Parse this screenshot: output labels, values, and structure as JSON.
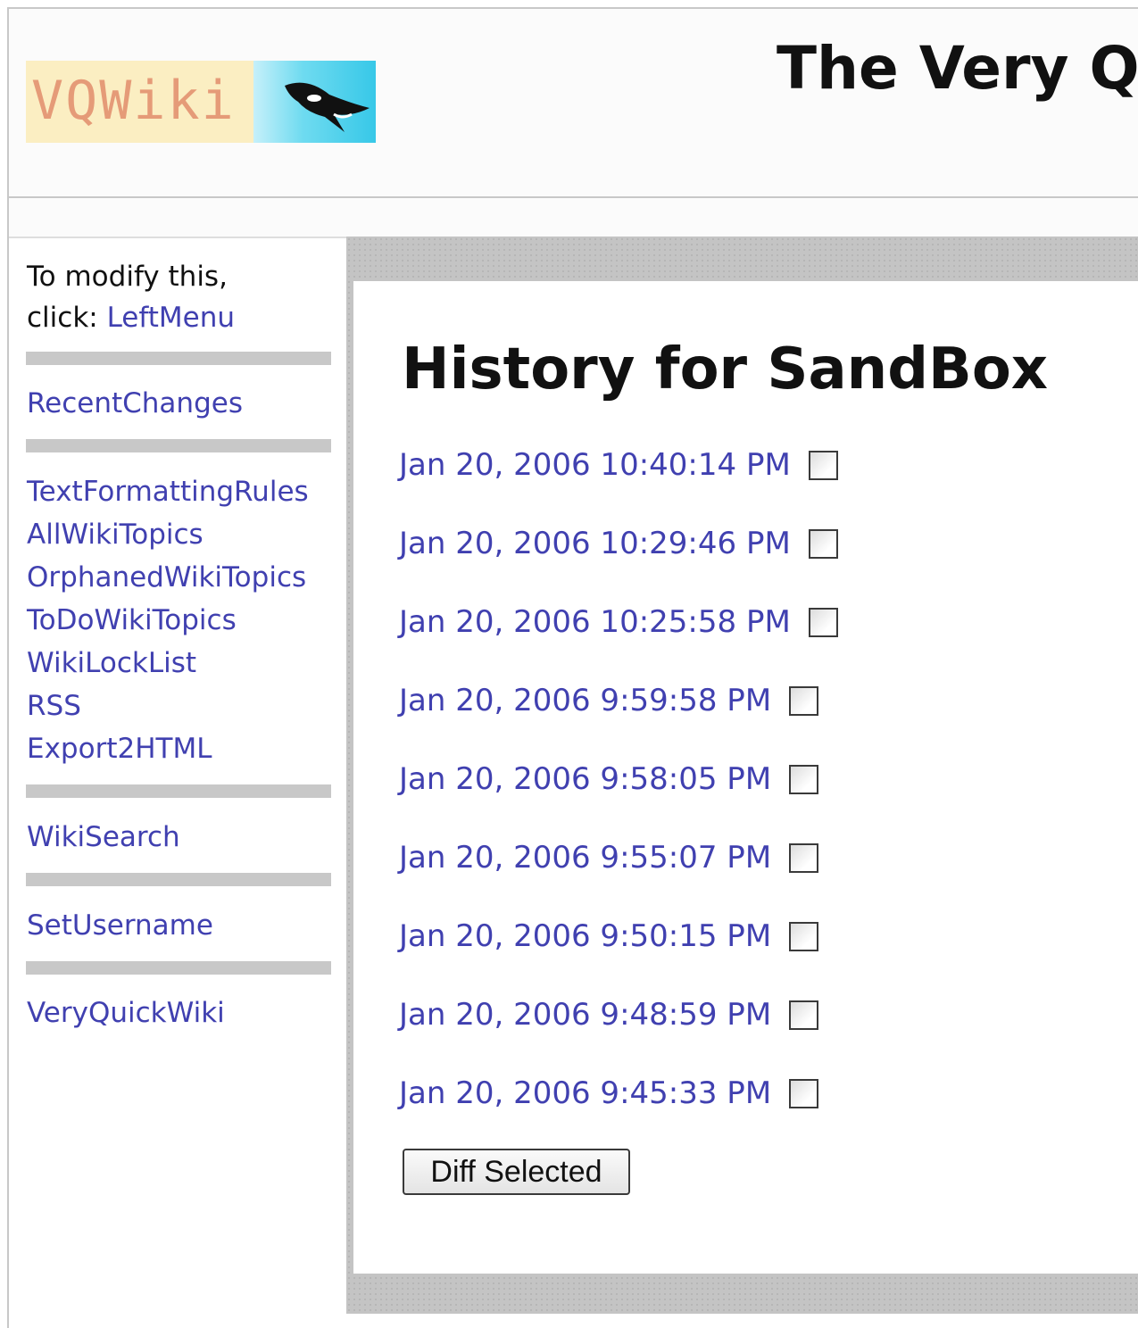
{
  "header": {
    "logo_text": "VQWiki",
    "site_title": "The Very Q"
  },
  "left_menu": {
    "intro_line1": "To modify this,",
    "intro_line2": "click:",
    "left_menu_link": "LeftMenu",
    "group1": [
      "RecentChanges"
    ],
    "group2": [
      "TextFormattingRules",
      "AllWikiTopics",
      "OrphanedWikiTopics",
      "ToDoWikiTopics",
      "WikiLockList",
      "RSS",
      "Export2HTML"
    ],
    "group3": [
      "WikiSearch"
    ],
    "group4": [
      "SetUsername"
    ],
    "group5": [
      "VeryQuickWiki"
    ]
  },
  "main": {
    "title": "History for SandBox",
    "revisions": [
      "Jan 20, 2006 10:40:14 PM",
      "Jan 20, 2006 10:29:46 PM",
      "Jan 20, 2006 10:25:58 PM",
      "Jan 20, 2006 9:59:58 PM",
      "Jan 20, 2006 9:58:05 PM",
      "Jan 20, 2006 9:55:07 PM",
      "Jan 20, 2006 9:50:15 PM",
      "Jan 20, 2006 9:48:59 PM",
      "Jan 20, 2006 9:45:33 PM"
    ],
    "diff_button_label": "Diff Selected"
  },
  "colors": {
    "link": "#4040b0",
    "separator": "#c8c8c8",
    "logo_bg": "#fbeec2",
    "logo_text": "#e59b78",
    "logo_water": "#37c8e8"
  }
}
